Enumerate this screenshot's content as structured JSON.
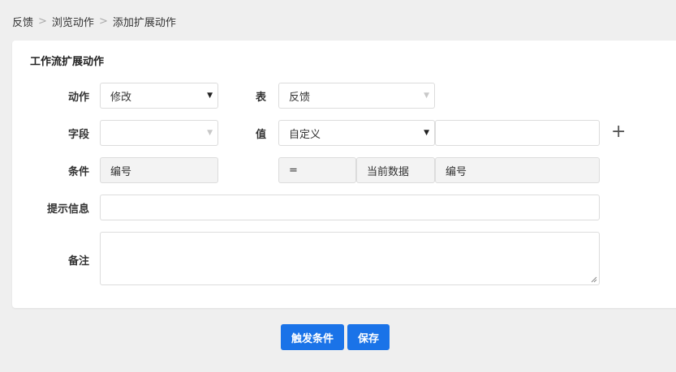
{
  "breadcrumb": {
    "items": [
      "反馈",
      "浏览动作",
      "添加扩展动作"
    ],
    "separator": ">"
  },
  "panel": {
    "title": "工作流扩展动作"
  },
  "form": {
    "action": {
      "label": "动作",
      "value": "修改"
    },
    "table": {
      "label": "表",
      "value": "反馈"
    },
    "field": {
      "label": "字段",
      "value": ""
    },
    "value": {
      "label": "值",
      "mode": "自定义",
      "input": ""
    },
    "condition": {
      "label": "条件",
      "left": "编号",
      "operator": "=",
      "source": "当前数据",
      "right": "编号"
    },
    "hint": {
      "label": "提示信息",
      "value": ""
    },
    "remark": {
      "label": "备注",
      "value": ""
    },
    "add_icon": "plus-icon"
  },
  "buttons": {
    "trigger": "触发条件",
    "save": "保存"
  },
  "colors": {
    "primary": "#1a73e8",
    "background": "#efefef",
    "disabled_bg": "#f3f3f3"
  }
}
